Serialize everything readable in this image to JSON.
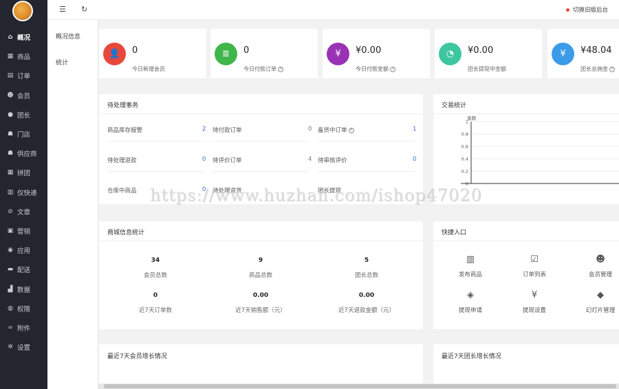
{
  "sidebar": {
    "items": [
      {
        "label": "概况",
        "icon": "home-icon",
        "glyph": "⌂",
        "active": true
      },
      {
        "label": "商品",
        "icon": "goods-icon",
        "glyph": "▦"
      },
      {
        "label": "订单",
        "icon": "order-icon",
        "glyph": "▤"
      },
      {
        "label": "会员",
        "icon": "member-icon",
        "glyph": "☻"
      },
      {
        "label": "团长",
        "icon": "leader-icon",
        "glyph": "●"
      },
      {
        "label": "门店",
        "icon": "store-icon",
        "glyph": "☗"
      },
      {
        "label": "供应商",
        "icon": "supplier-icon",
        "glyph": "☗"
      },
      {
        "label": "拼团",
        "icon": "group-buy-icon",
        "glyph": "▦"
      },
      {
        "label": "仅快递",
        "icon": "express-icon",
        "glyph": "▥"
      },
      {
        "label": "文章",
        "icon": "article-icon",
        "glyph": "⊘"
      },
      {
        "label": "营销",
        "icon": "marketing-icon",
        "glyph": "▣"
      },
      {
        "label": "应用",
        "icon": "app-icon",
        "glyph": "◉"
      },
      {
        "label": "配送",
        "icon": "delivery-icon",
        "glyph": "▬"
      },
      {
        "label": "数据",
        "icon": "data-icon",
        "glyph": "▟"
      },
      {
        "label": "权限",
        "icon": "permission-icon",
        "glyph": "◍"
      },
      {
        "label": "附件",
        "icon": "attachment-icon",
        "glyph": "∞"
      },
      {
        "label": "设置",
        "icon": "settings-icon",
        "glyph": "✲"
      }
    ]
  },
  "submenu": {
    "overview": "概况信息",
    "stats": "统计"
  },
  "topbar": {
    "menu_glyph": "☰",
    "refresh_glyph": "↻",
    "switch_label": "切换旧版后台"
  },
  "stats": [
    {
      "value": "0",
      "label": "今日新增会员",
      "color": "#e8483b",
      "glyph": "👤",
      "icon": "add-user-icon",
      "help": false
    },
    {
      "value": "0",
      "label": "今日付款订单",
      "color": "#3fb54a",
      "glyph": "≣",
      "icon": "order-list-icon",
      "help": true
    },
    {
      "value": "¥0.00",
      "label": "今日付款金额",
      "color": "#9a32b5",
      "glyph": "¥",
      "icon": "yen-icon",
      "help": true
    },
    {
      "value": "¥0.00",
      "label": "团长提现中金额",
      "color": "#3dc6a0",
      "glyph": "◔",
      "icon": "pie-icon",
      "help": false
    },
    {
      "value": "¥48.04",
      "label": "团长总佣金",
      "color": "#3c9be8",
      "glyph": "¥",
      "icon": "money-bag-icon",
      "help": true
    }
  ],
  "todo": {
    "title": "待处理事务",
    "help_glyph": "?",
    "rows": [
      [
        {
          "label": "商品库存报警",
          "value": "2"
        },
        {
          "label": "待付款订单",
          "value": "0"
        },
        {
          "label": "备货中订单",
          "value": "1",
          "help": true
        }
      ],
      [
        {
          "label": "待处理退款",
          "value": "0"
        },
        {
          "label": "待评价订单",
          "value": "4"
        },
        {
          "label": "待审核评价",
          "value": "0"
        }
      ],
      [
        {
          "label": "仓库中商品",
          "value": "0"
        },
        {
          "label": "待处理退货",
          "value": ""
        },
        {
          "label": "团长提现",
          "value": ""
        }
      ]
    ]
  },
  "trade": {
    "title": "交易统计",
    "chart_data": {
      "type": "line",
      "ylabel": "金额",
      "yticks": [
        "1",
        "0.8",
        "0.6",
        "0.4",
        "0.2",
        "0"
      ],
      "ylim": [
        0,
        1
      ],
      "categories": [
        "09-20",
        "09-21",
        "09-22",
        "09-23",
        "09-24"
      ],
      "visible_xticks": [
        "09-22",
        "09-23",
        "09-24"
      ],
      "series": [
        {
          "values": [
            0,
            0,
            0,
            0,
            0
          ]
        }
      ],
      "grid": true
    }
  },
  "mall": {
    "title": "商城信息统计",
    "items": [
      {
        "value": "34",
        "label": "会员总数"
      },
      {
        "value": "9",
        "label": "商品总数"
      },
      {
        "value": "5",
        "label": "团长总数"
      },
      {
        "value": "0",
        "label": "近7天订单数"
      },
      {
        "value": "0.00",
        "label": "近7天销售额（元）"
      },
      {
        "value": "0.00",
        "label": "近7天退款金额（元）"
      }
    ]
  },
  "quick": {
    "title": "快捷入口",
    "items": [
      {
        "label": "发布商品",
        "icon": "barcode-icon",
        "glyph": "▥"
      },
      {
        "label": "订单列表",
        "icon": "clipboard-icon",
        "glyph": "☑"
      },
      {
        "label": "会员管理",
        "icon": "members-icon",
        "glyph": "☻"
      },
      {
        "label": "提现申请",
        "icon": "ticket-icon",
        "glyph": "◈"
      },
      {
        "label": "提现设置",
        "icon": "yen-circle-icon",
        "glyph": "¥"
      },
      {
        "label": "幻灯片管理",
        "icon": "tag-icon",
        "glyph": "◆"
      }
    ]
  },
  "bottom": {
    "member_growth": "最近7天会员增长情况",
    "leader_growth": "最近7天团长增长情况"
  },
  "watermark": "https://www.huzhan.com/ishop47020"
}
